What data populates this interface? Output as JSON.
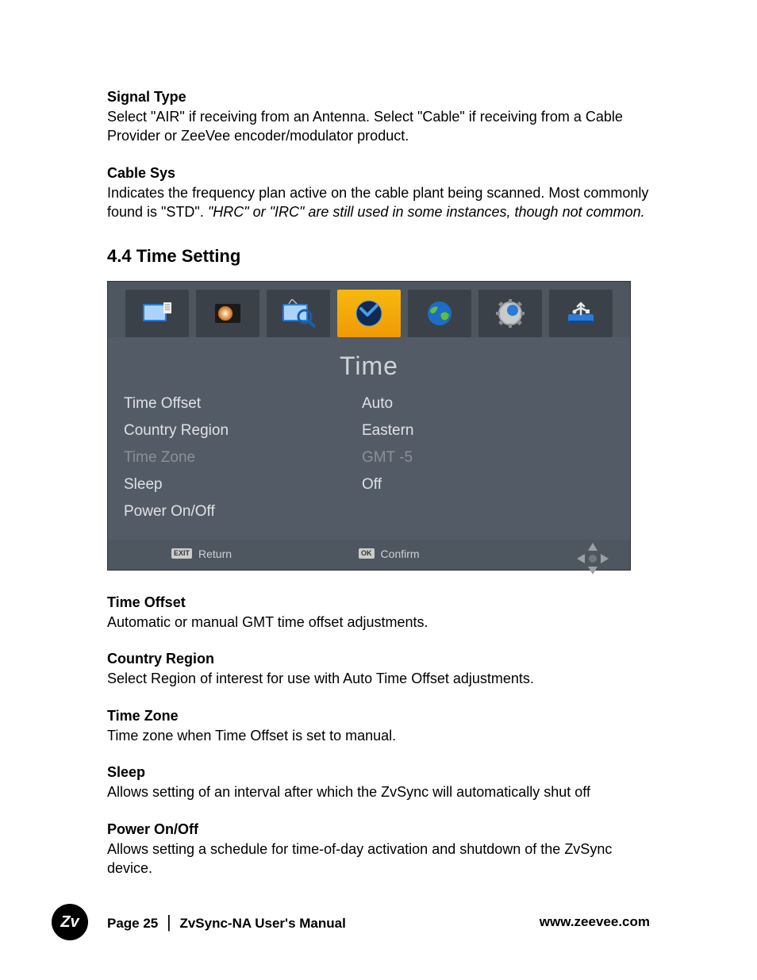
{
  "sections": {
    "signal_type": {
      "heading": "Signal Type",
      "body": "Select \"AIR\" if receiving from an Antenna.  Select \"Cable\" if receiving from a Cable Provider or ZeeVee encoder/modulator product."
    },
    "cable_sys": {
      "heading": "Cable Sys",
      "body_a": "Indicates the frequency plan active on the cable plant being scanned.  Most commonly found is \"STD\".  ",
      "body_b_italic": "\"HRC\" or \"IRC\" are still used in some instances, though not common."
    },
    "h2": "4.4  Time Setting",
    "time_offset": {
      "heading": "Time Offset",
      "body": "Automatic or manual GMT time offset adjustments."
    },
    "country_region": {
      "heading": "Country Region",
      "body": "Select Region of interest for use with Auto Time Offset adjustments."
    },
    "time_zone": {
      "heading": "Time Zone",
      "body": "Time zone when Time Offset is set to manual."
    },
    "sleep": {
      "heading": "Sleep",
      "body": "Allows setting of an interval after which the ZvSync will automatically shut off"
    },
    "power": {
      "heading": "Power On/Off",
      "body": "Allows setting a schedule for time-of-day activation and shutdown of the ZvSync device."
    }
  },
  "osd": {
    "title": "Time",
    "rows": [
      {
        "label": "Time Offset",
        "value": "Auto",
        "dim": false
      },
      {
        "label": "Country Region",
        "value": "Eastern",
        "dim": false
      },
      {
        "label": "Time Zone",
        "value": "GMT -5",
        "dim": true
      },
      {
        "label": "Sleep",
        "value": "Off",
        "dim": false
      },
      {
        "label": "Power On/Off",
        "value": "",
        "dim": false
      }
    ],
    "footer": {
      "exit_key": "EXIT",
      "exit_label": "Return",
      "ok_key": "OK",
      "ok_label": "Confirm"
    },
    "tabs": [
      "channel-icon",
      "picture-icon",
      "search-icon",
      "clock-icon",
      "globe-icon",
      "gear-icon",
      "usb-icon"
    ],
    "active_tab_index": 3
  },
  "footer": {
    "logo_text": "Zv",
    "page": "Page 25",
    "sep": "|",
    "title": "ZvSync-NA User's Manual",
    "url": "www.zeevee.com"
  }
}
